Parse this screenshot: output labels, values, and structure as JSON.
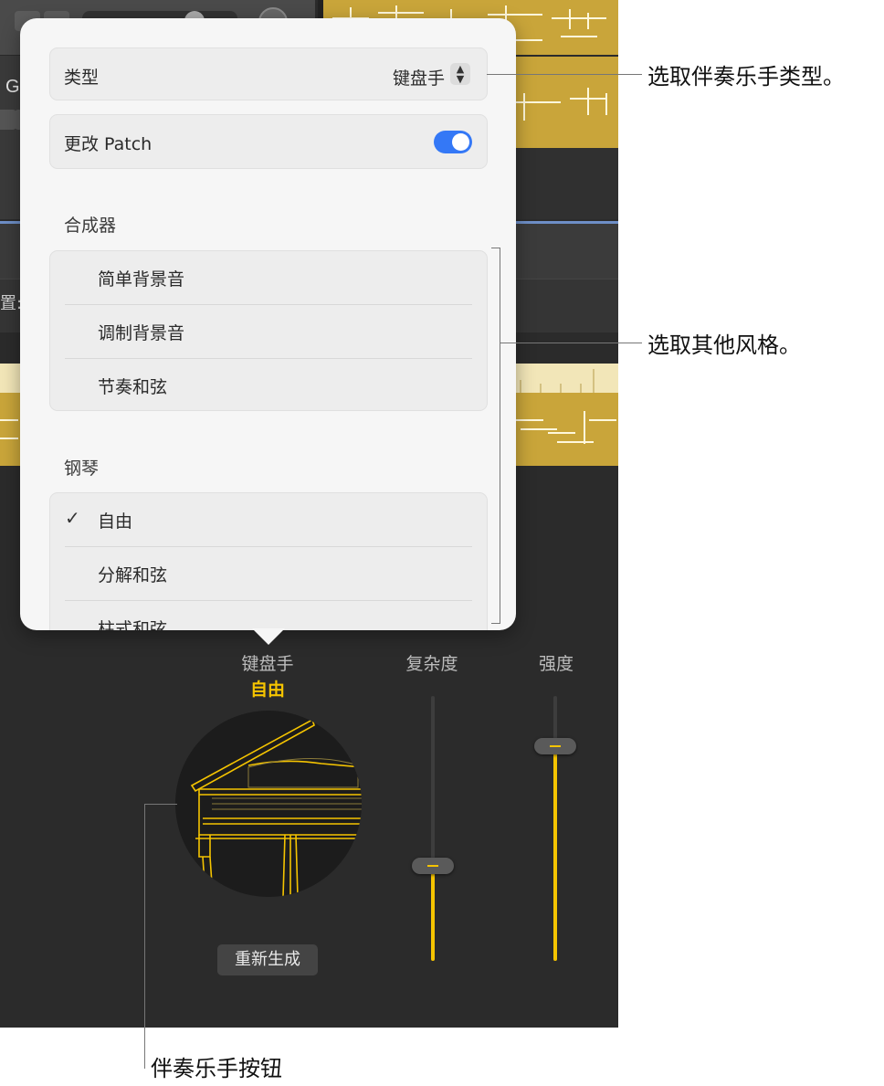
{
  "popover": {
    "type_row": {
      "label": "类型",
      "value": "键盘手"
    },
    "patch_row": {
      "label": "更改 Patch",
      "toggle_on": true
    },
    "sections": [
      {
        "heading": "合成器",
        "items": [
          {
            "label": "简单背景音",
            "checked": false
          },
          {
            "label": "调制背景音",
            "checked": false
          },
          {
            "label": "节奏和弦",
            "checked": false
          }
        ]
      },
      {
        "heading": "钢琴",
        "items": [
          {
            "label": "自由",
            "checked": true,
            "check_mark": "✓"
          },
          {
            "label": "分解和弦",
            "checked": false
          },
          {
            "label": "柱式和弦",
            "checked": false
          }
        ]
      }
    ]
  },
  "controls": {
    "player_label": "键盘手",
    "style_label": "自由",
    "complexity_label": "复杂度",
    "intensity_label": "强度",
    "regenerate_label": "重新生成",
    "complexity_level": 0.36,
    "intensity_level": 0.81
  },
  "background": {
    "header_letter": "G",
    "field_label": "置:"
  },
  "callouts": {
    "type": "选取伴奏乐手类型。",
    "style": "选取其他风格。",
    "button": "伴奏乐手按钮"
  },
  "colors": {
    "accent": "#f5c400",
    "region": "#c9a53a",
    "toggle": "#3478f6"
  }
}
